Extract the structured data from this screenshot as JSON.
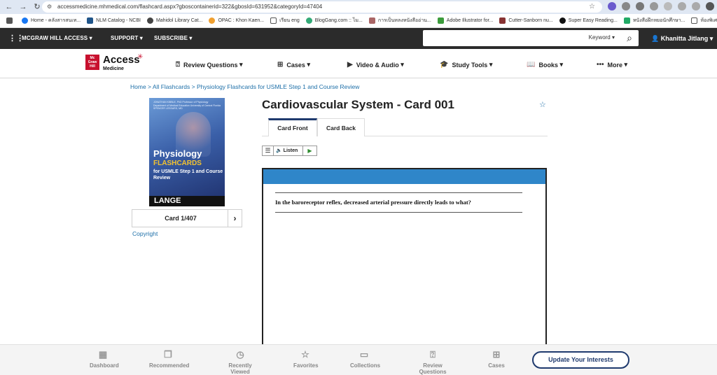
{
  "browser": {
    "url": "accessmedicine.mhmedical.com/flashcard.aspx?gboscontainerid=322&gbosId=631952&categoryId=47404",
    "bookmarks": [
      "Home - คลังสารสนเท...",
      "NLM Catalog - NCBI",
      "Mahidol Library Cat...",
      "OPAC : Khon Kaen...",
      "เรียน eng",
      "BlogGang.com :: ไม...",
      "การเป็นหลงหนังสืออ่าน...",
      "Adobe Illustrator for...",
      "Cutter-Sanborn nu...",
      "Super Easy Reading...",
      "หนังสือฝึกหยอนักศึกษา...",
      "ห้องพิเศ"
    ],
    "more_bookmarks": "»"
  },
  "topnav": {
    "brand": "MCGRAW HILL ACCESS",
    "support": "SUPPORT",
    "subscribe": "SUBSCRIBE",
    "search_placeholder": "",
    "search_scope": "Keyword",
    "user_name": "Khanitta Jitlang"
  },
  "site": {
    "logo_mh": "Mc Graw Hill",
    "logo_main": "Access",
    "logo_sub": "Medicine",
    "nav": [
      "Review Questions",
      "Cases",
      "Video & Audio",
      "Study Tools",
      "Books",
      "More"
    ]
  },
  "breadcrumb": "Home > All Flashcards > Physiology Flashcards for USMLE Step 1 and Course Review",
  "book": {
    "authors": "JONATHAN KIBBLE, PhD Professor of Physiology Department of Medical Education University of Central Florida  SPENCER LESSARD, MD",
    "title_line1": "Physiology",
    "title_line2": "FLASHCARDS",
    "title_line3": "for USMLE Step 1 and Course Review",
    "publisher": "LANGE"
  },
  "card_nav": {
    "label": "Card 1/407",
    "next": "›"
  },
  "copyright": "Copyright",
  "card": {
    "title": "Cardiovascular System - Card 001",
    "tabs": [
      "Card Front",
      "Card Back"
    ],
    "listen_label": "Listen",
    "question": "In the baroreceptor reflex, decreased arterial pressure directly leads to what?"
  },
  "bottombar": {
    "items": [
      "Dashboard",
      "Recommended",
      "Recently Viewed",
      "Favorites",
      "Collections",
      "Review Questions",
      "Cases"
    ],
    "update_button": "Update Your Interests"
  },
  "colors": {
    "accent": "#1f3a6e",
    "band": "#2f86c9",
    "link": "#1d6fa8",
    "brand_red": "#c8102e"
  }
}
